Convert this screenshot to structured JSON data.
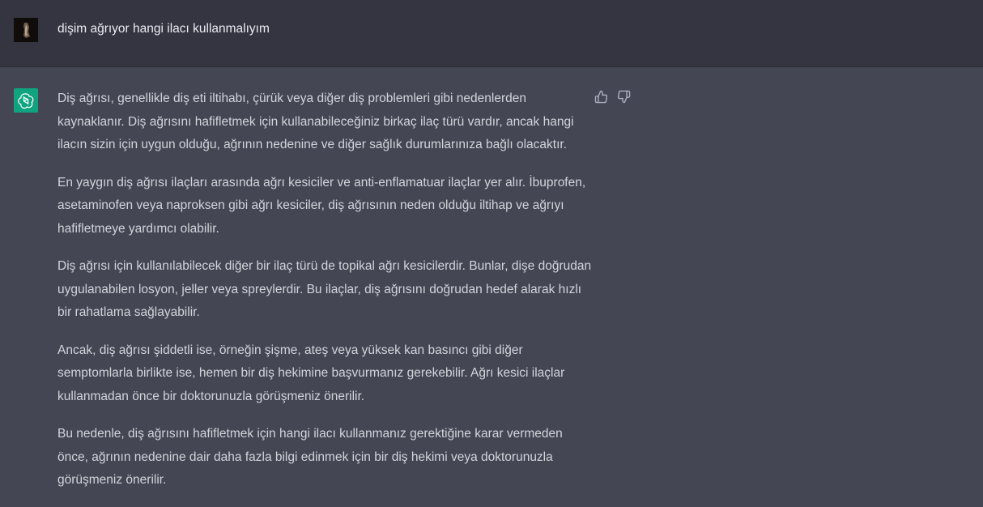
{
  "user_message": {
    "text": "dişim ağrıyor hangi ilacı kullanmalıyım"
  },
  "assistant_message": {
    "paragraphs": [
      "Diş ağrısı, genellikle diş eti iltihabı, çürük veya diğer diş problemleri gibi nedenlerden kaynaklanır. Diş ağrısını hafifletmek için kullanabileceğiniz birkaç ilaç türü vardır, ancak hangi ilacın sizin için uygun olduğu, ağrının nedenine ve diğer sağlık durumlarınıza bağlı olacaktır.",
      "En yaygın diş ağrısı ilaçları arasında ağrı kesiciler ve anti-enflamatuar ilaçlar yer alır. İbuprofen, asetaminofen veya naproksen gibi ağrı kesiciler, diş ağrısının neden olduğu iltihap ve ağrıyı hafifletmeye yardımcı olabilir.",
      "Diş ağrısı için kullanılabilecek diğer bir ilaç türü de topikal ağrı kesicilerdir. Bunlar, dişe doğrudan uygulanabilen losyon, jeller veya spreylerdir. Bu ilaçlar, diş ağrısını doğrudan hedef alarak hızlı bir rahatlama sağlayabilir.",
      "Ancak, diş ağrısı şiddetli ise, örneğin şişme, ateş veya yüksek kan basıncı gibi diğer semptomlarla birlikte ise, hemen bir diş hekimine başvurmanız gerekebilir. Ağrı kesici ilaçlar kullanmadan önce bir doktorunuzla görüşmeniz önerilir.",
      "Bu nedenle, diş ağrısını hafifletmek için hangi ilacı kullanmanız gerektiğine karar vermeden önce, ağrının nedenine dair daha fazla bilgi edinmek için bir diş hekimi veya doktorunuzla görüşmeniz önerilir."
    ]
  },
  "icons": {
    "user_avatar": "user-avatar-image",
    "assistant_avatar": "openai-logo-icon",
    "feedback_up": "thumbs-up-icon",
    "feedback_down": "thumbs-down-icon"
  },
  "colors": {
    "user_row_bg": "#343541",
    "assistant_row_bg": "#444654",
    "assistant_avatar_bg": "#10a37f",
    "text": "#d1d5db"
  }
}
